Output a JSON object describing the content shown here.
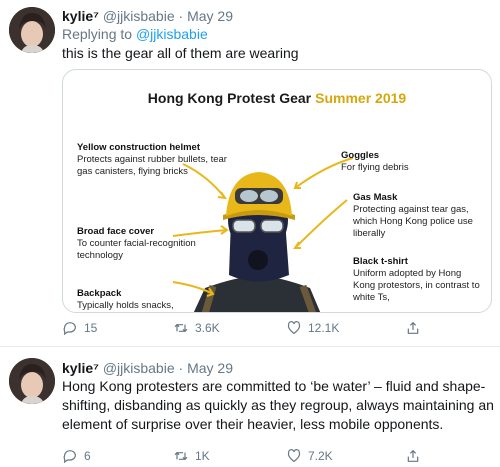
{
  "tweets": [
    {
      "display_name": "kylie⁷",
      "handle": "@jjkisbabie",
      "separator": "·",
      "date": "May 29",
      "replying_label": "Replying to",
      "replying_handle": "@jjkisbabie",
      "text": "this is the gear all of them are wearing",
      "media": {
        "title": "Hong Kong Protest Gear",
        "title_year": "Summer 2019",
        "labels": {
          "helmet_title": "Yellow construction helmet",
          "helmet_text": "Protects against rubber bullets, tear gas canisters, flying bricks",
          "face_title": "Broad face cover",
          "face_text": "To counter facial-recognition technology",
          "backpack_title": "Backpack",
          "backpack_text": "Typically holds snacks,",
          "goggles_title": "Goggles",
          "goggles_text": "For flying debris",
          "gasmask_title": "Gas Mask",
          "gasmask_text": "Protecting against tear gas, which Hong Kong police use liberally",
          "tshirt_title": "Black t-shirt",
          "tshirt_text": "Uniform adopted by Hong Kong protestors, in contrast to white Ts,"
        }
      },
      "actions": {
        "replies": "15",
        "retweets": "3.6K",
        "likes": "12.1K"
      }
    },
    {
      "display_name": "kylie⁷",
      "handle": "@jjkisbabie",
      "separator": "·",
      "date": "May 29",
      "text": "Hong Kong protesters are committed to ‘be water’ – fluid and shape-shifting, disbanding as quickly as they regroup, always maintaining an element of surprise over their heavier, less mobile opponents.",
      "actions": {
        "replies": "6",
        "retweets": "1K",
        "likes": "7.2K"
      }
    }
  ],
  "icons": {
    "reply": "reply-icon",
    "retweet": "retweet-icon",
    "like": "heart-icon",
    "share": "share-icon"
  },
  "colors": {
    "link": "#1da1f2",
    "muted": "#657786",
    "helmet_yellow": "#e8b81a",
    "title_year": "#d6a70d"
  }
}
